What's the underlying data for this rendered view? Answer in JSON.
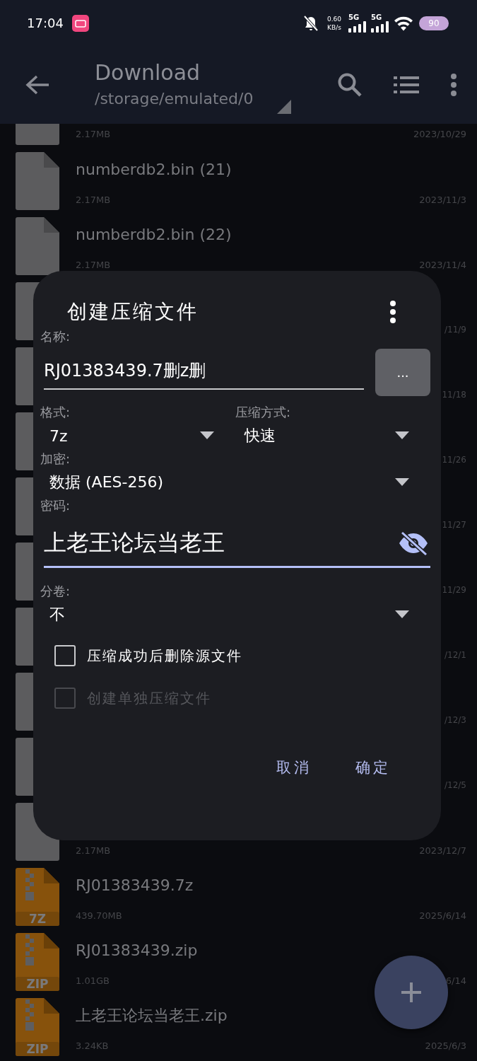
{
  "status_bar": {
    "time": "17:04",
    "net_speed": "0.60",
    "net_unit": "KB/s",
    "signals": [
      "5G",
      "5G"
    ],
    "battery": "90"
  },
  "app_bar": {
    "title": "Download",
    "path": "/storage/emulated/0"
  },
  "files": [
    {
      "kind": "partial",
      "size": "2.17MB",
      "date": "2023/10/29"
    },
    {
      "kind": "file",
      "name": "numberdb2.bin (21)",
      "size": "2.17MB",
      "date": "2023/11/3"
    },
    {
      "kind": "file",
      "name": "numberdb2.bin (22)",
      "size": "2.17MB",
      "date": "2023/11/4"
    },
    {
      "kind": "covered",
      "date": "/11/9"
    },
    {
      "kind": "covered",
      "date": "11/18"
    },
    {
      "kind": "covered",
      "date": "11/26"
    },
    {
      "kind": "covered",
      "date": "11/27"
    },
    {
      "kind": "covered",
      "date": "11/29"
    },
    {
      "kind": "covered",
      "date": "/12/1"
    },
    {
      "kind": "covered",
      "date": "/12/3"
    },
    {
      "kind": "covered",
      "date": "/12/5"
    },
    {
      "kind": "file",
      "size": "2.17MB",
      "date": "2023/12/7"
    },
    {
      "kind": "archive",
      "type_label": "7Z",
      "name": "RJ01383439.7z",
      "size": "439.70MB",
      "date": "2025/6/14"
    },
    {
      "kind": "archive",
      "type_label": "ZIP",
      "name": "RJ01383439.zip",
      "size": "1.01GB",
      "date": "6/14"
    },
    {
      "kind": "archive",
      "type_label": "ZIP",
      "name": "上老王论坛当老王.zip",
      "size": "3.24KB",
      "date": "2025/6/3"
    }
  ],
  "dialog": {
    "title": "创建压缩文件",
    "name_label": "名称:",
    "name_value": "RJ01383439.7删z删",
    "browse_button": "...",
    "format_label": "格式:",
    "format_value": "7z",
    "method_label": "压缩方式:",
    "method_value": "快速",
    "encryption_label": "加密:",
    "encryption_value": "数据 (AES-256)",
    "password_label": "密码:",
    "password_value": "上老王论坛当老王",
    "password_visible": true,
    "split_label": "分卷:",
    "split_value": "不",
    "checkboxes": [
      {
        "label": "压缩成功后删除源文件",
        "checked": false,
        "disabled": false
      },
      {
        "label": "创建单独压缩文件",
        "checked": false,
        "disabled": true
      }
    ],
    "buttons": [
      "取消",
      "确定"
    ]
  }
}
